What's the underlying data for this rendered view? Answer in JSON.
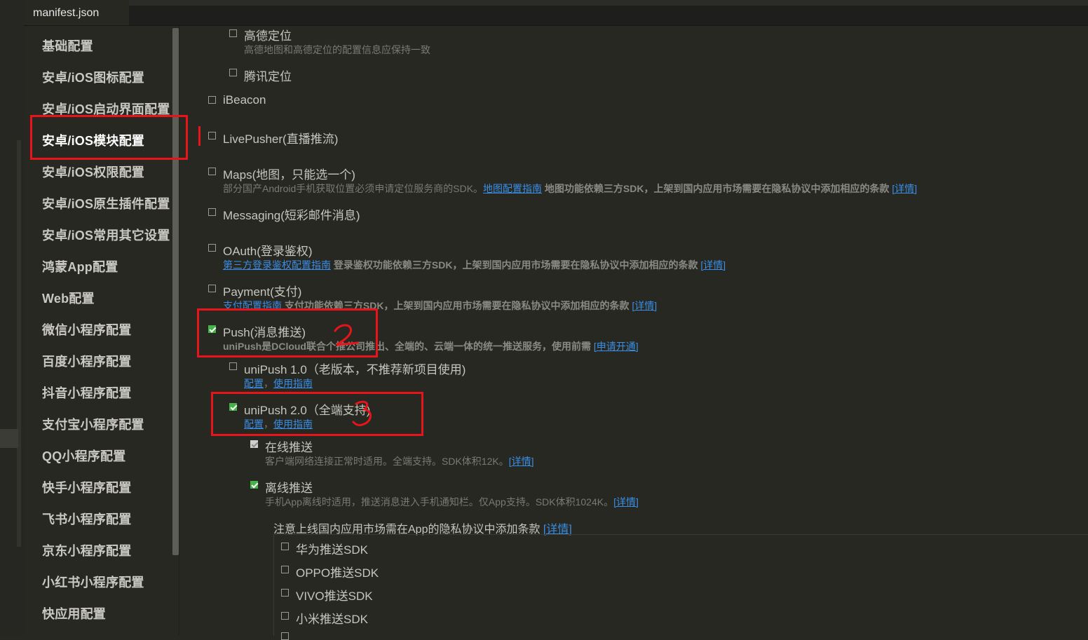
{
  "tab": {
    "title": "manifest.json"
  },
  "sidebar": {
    "items": [
      {
        "label": "基础配置"
      },
      {
        "label": "安卓/iOS图标配置"
      },
      {
        "label": "安卓/iOS启动界面配置"
      },
      {
        "label": "安卓/iOS模块配置"
      },
      {
        "label": "安卓/iOS权限配置"
      },
      {
        "label": "安卓/iOS原生插件配置"
      },
      {
        "label": "安卓/iOS常用其它设置"
      },
      {
        "label": "鸿蒙App配置"
      },
      {
        "label": "Web配置"
      },
      {
        "label": "微信小程序配置"
      },
      {
        "label": "百度小程序配置"
      },
      {
        "label": "抖音小程序配置"
      },
      {
        "label": "支付宝小程序配置"
      },
      {
        "label": "QQ小程序配置"
      },
      {
        "label": "快手小程序配置"
      },
      {
        "label": "飞书小程序配置"
      },
      {
        "label": "京东小程序配置"
      },
      {
        "label": "小红书小程序配置"
      },
      {
        "label": "快应用配置"
      }
    ],
    "active_index": 3
  },
  "modules": {
    "amap": {
      "label": "高德定位",
      "desc": "高德地图和高德定位的配置信息应保持一致",
      "checked": false
    },
    "tencent_loc": {
      "label": "腾讯定位",
      "checked": false
    },
    "ibeacon": {
      "label": "iBeacon",
      "checked": false
    },
    "livepusher": {
      "label": "LivePusher(直播推流)",
      "checked": false
    },
    "maps": {
      "label": "Maps(地图，只能选一个)",
      "desc_prefix": "部分国产Android手机获取位置必须申请定位服务商的SDK。",
      "link_guide": "地图配置指南",
      "desc_bold": " 地图功能依赖三方SDK，上架到国内应用市场需要在隐私协议中添加相应的条款 ",
      "link_detail": "[详情]",
      "checked": false
    },
    "messaging": {
      "label": "Messaging(短彩邮件消息)",
      "checked": false
    },
    "oauth": {
      "label": "OAuth(登录鉴权)",
      "link_guide": "第三方登录鉴权配置指南",
      "desc_bold": " 登录鉴权功能依赖三方SDK，上架到国内应用市场需要在隐私协议中添加相应的条款 ",
      "link_detail": "[详情]",
      "checked": false
    },
    "payment": {
      "label": "Payment(支付)",
      "link_guide": "支付配置指南",
      "desc_bold": " 支付功能依赖三方SDK，上架到国内应用市场需要在隐私协议中添加相应的条款 ",
      "link_detail": "[详情]",
      "checked": false
    },
    "push": {
      "label": "Push(消息推送)",
      "desc_bold": "uniPush是DCloud联合个推公司推出、全端的、云端一体的统一推送服务，使用前需 ",
      "link_apply": "[申请开通]",
      "checked": true
    },
    "unipush1": {
      "label": "uniPush 1.0（老版本，不推荐新项目使用)",
      "link_config": "配置",
      "sep": "，",
      "link_guide": "使用指南",
      "checked": false
    },
    "unipush2": {
      "label": "uniPush 2.0（全端支持)",
      "link_config": "配置",
      "sep": "，",
      "link_guide": "使用指南",
      "checked": true
    },
    "online_push": {
      "label": "在线推送",
      "desc": "客户端网络连接正常时适用。全端支持。SDK体积12K。",
      "link_detail": "[详情]",
      "checked": true,
      "disabled": true
    },
    "offline_push": {
      "label": "离线推送",
      "desc": "手机App离线时适用，推送消息进入手机通知栏。仅App支持。SDK体积1024K。",
      "link_detail": "[详情]",
      "checked": true
    },
    "privacy_note": {
      "text": "注意上线国内应用市场需在App的隐私协议中添加条款 ",
      "link_detail": "[详情]"
    },
    "vendors": [
      {
        "label": "华为推送SDK",
        "checked": false
      },
      {
        "label": "OPPO推送SDK",
        "checked": false
      },
      {
        "label": "VIVO推送SDK",
        "checked": false
      },
      {
        "label": "小米推送SDK",
        "checked": false
      }
    ]
  },
  "colors": {
    "annotation": "#e8141b",
    "link": "#3a8ee6",
    "checkbox_on": "#45b34a",
    "background": "#272822"
  }
}
